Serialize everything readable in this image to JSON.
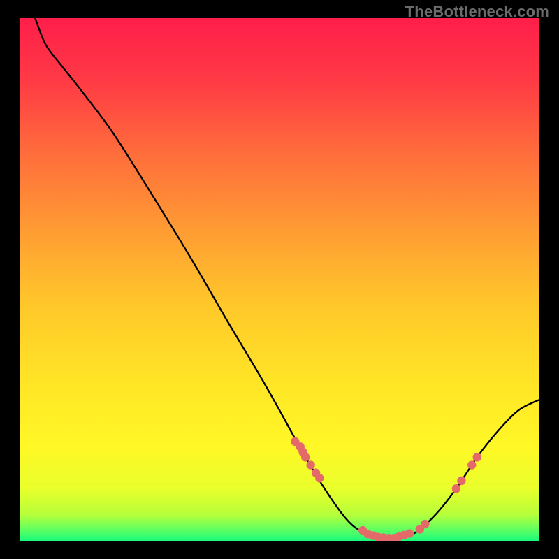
{
  "watermark": "TheBottleneck.com",
  "chart_data": {
    "type": "line",
    "title": "",
    "xlabel": "",
    "ylabel": "",
    "xlim": [
      0,
      100
    ],
    "ylim": [
      0,
      100
    ],
    "curve": [
      {
        "x": 3,
        "y": 100
      },
      {
        "x": 5,
        "y": 95
      },
      {
        "x": 8,
        "y": 91
      },
      {
        "x": 12,
        "y": 86
      },
      {
        "x": 18,
        "y": 78
      },
      {
        "x": 25,
        "y": 67
      },
      {
        "x": 33,
        "y": 54
      },
      {
        "x": 40,
        "y": 42
      },
      {
        "x": 46,
        "y": 32
      },
      {
        "x": 50,
        "y": 25
      },
      {
        "x": 55,
        "y": 16
      },
      {
        "x": 60,
        "y": 8
      },
      {
        "x": 64,
        "y": 3
      },
      {
        "x": 68,
        "y": 1
      },
      {
        "x": 72,
        "y": 0.5
      },
      {
        "x": 76,
        "y": 1.5
      },
      {
        "x": 80,
        "y": 5
      },
      {
        "x": 84,
        "y": 10
      },
      {
        "x": 88,
        "y": 16
      },
      {
        "x": 92,
        "y": 21
      },
      {
        "x": 96,
        "y": 25
      },
      {
        "x": 100,
        "y": 27
      }
    ],
    "markers": [
      {
        "x": 53,
        "y": 19
      },
      {
        "x": 54,
        "y": 18
      },
      {
        "x": 55,
        "y": 16
      },
      {
        "x": 54.5,
        "y": 17
      },
      {
        "x": 56,
        "y": 14.5
      },
      {
        "x": 57,
        "y": 13
      },
      {
        "x": 57.7,
        "y": 12
      },
      {
        "x": 66,
        "y": 2
      },
      {
        "x": 67,
        "y": 1.3
      },
      {
        "x": 68,
        "y": 1
      },
      {
        "x": 69,
        "y": 0.7
      },
      {
        "x": 70,
        "y": 0.6
      },
      {
        "x": 71,
        "y": 0.5
      },
      {
        "x": 72,
        "y": 0.5
      },
      {
        "x": 73,
        "y": 0.8
      },
      {
        "x": 74,
        "y": 1.1
      },
      {
        "x": 75,
        "y": 1.4
      },
      {
        "x": 77,
        "y": 2.2
      },
      {
        "x": 78,
        "y": 3.2
      },
      {
        "x": 84,
        "y": 10
      },
      {
        "x": 85,
        "y": 11.5
      },
      {
        "x": 87,
        "y": 14.5
      },
      {
        "x": 88,
        "y": 16
      }
    ],
    "gradient_stops": [
      {
        "pos": 0.0,
        "color": "#ff1e4a"
      },
      {
        "pos": 0.12,
        "color": "#ff3a45"
      },
      {
        "pos": 0.25,
        "color": "#ff6a3c"
      },
      {
        "pos": 0.4,
        "color": "#ff9a33"
      },
      {
        "pos": 0.55,
        "color": "#ffc82a"
      },
      {
        "pos": 0.7,
        "color": "#ffe526"
      },
      {
        "pos": 0.82,
        "color": "#fff826"
      },
      {
        "pos": 0.9,
        "color": "#e9ff2b"
      },
      {
        "pos": 0.95,
        "color": "#b6ff3a"
      },
      {
        "pos": 0.985,
        "color": "#4bff6a"
      },
      {
        "pos": 1.0,
        "color": "#18f97a"
      }
    ],
    "marker_color": "#e46a6a",
    "curve_color": "#000000"
  }
}
